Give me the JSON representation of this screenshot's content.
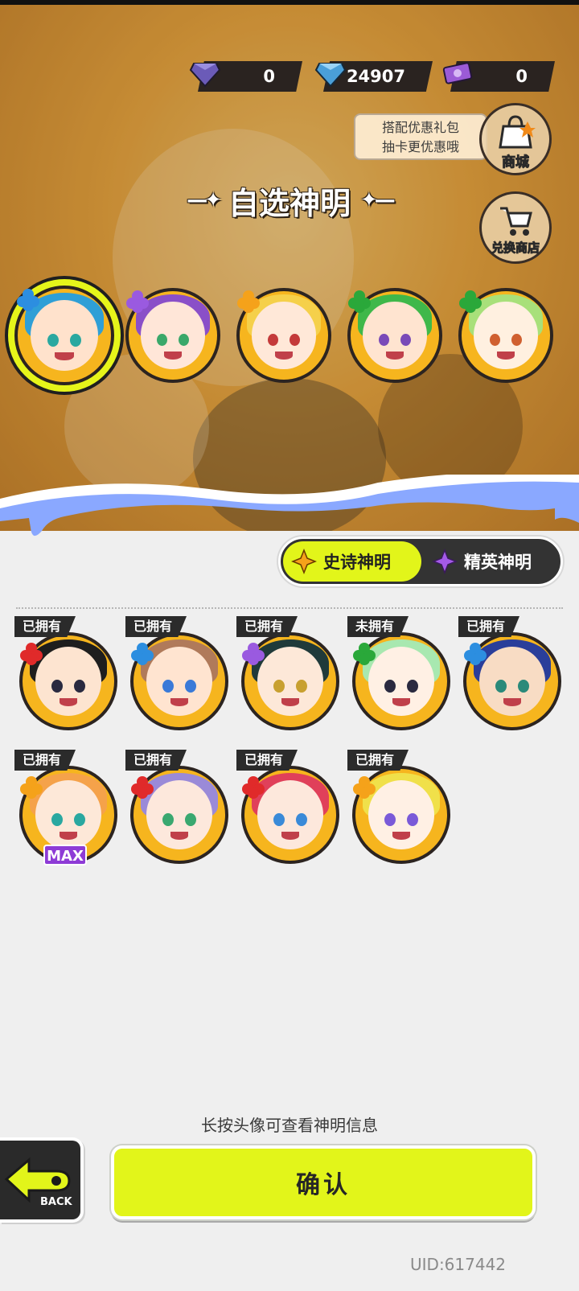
{
  "currency": [
    {
      "name": "purple-gem",
      "value": "0"
    },
    {
      "name": "blue-diamond",
      "value": "24907"
    },
    {
      "name": "ticket",
      "value": "0"
    }
  ],
  "promo": {
    "line1": "搭配优惠礼包",
    "line2": "抽卡更优惠哦"
  },
  "shop_button": {
    "label": "商城"
  },
  "exchange_button": {
    "label": "兑换商店"
  },
  "title": "自选神明",
  "tabs": [
    {
      "label": "史诗神明",
      "active": true
    },
    {
      "label": "精英神明",
      "active": false
    }
  ],
  "grid": [
    {
      "status": "已拥有",
      "max": ""
    },
    {
      "status": "已拥有",
      "max": ""
    },
    {
      "status": "已拥有",
      "max": ""
    },
    {
      "status": "未拥有",
      "max": ""
    },
    {
      "status": "已拥有",
      "max": ""
    },
    {
      "status": "已拥有",
      "max": "MAX"
    },
    {
      "status": "已拥有",
      "max": ""
    },
    {
      "status": "已拥有",
      "max": ""
    },
    {
      "status": "已拥有",
      "max": ""
    }
  ],
  "hint": "长按头像可查看神明信息",
  "back_label": "BACK",
  "confirm_label": "确认",
  "uid": "UID:617442"
}
